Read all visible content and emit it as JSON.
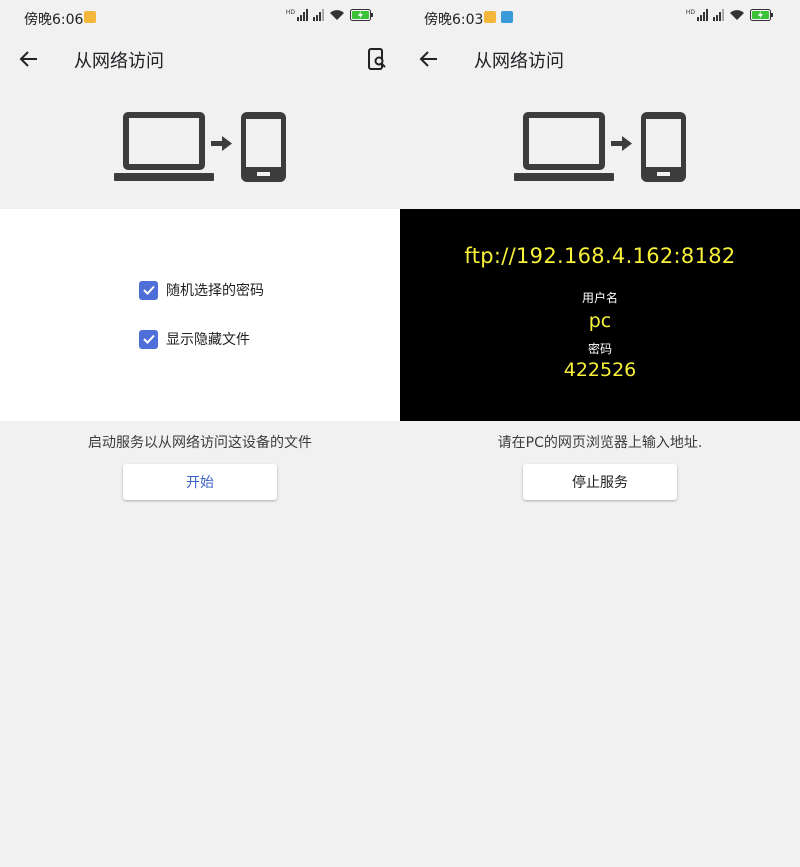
{
  "left_screen": {
    "status_bar": {
      "time": "傍晚6:06",
      "network_label": "HD"
    },
    "app_bar": {
      "title": "从网络访问"
    },
    "options": [
      {
        "label": "随机选择的密码",
        "checked": true
      },
      {
        "label": "显示隐藏文件",
        "checked": true
      }
    ],
    "caption": "启动服务以从网络访问这设备的文件",
    "button_label": "开始"
  },
  "right_screen": {
    "status_bar": {
      "time": "傍晚6:03",
      "network_label": "HD"
    },
    "app_bar": {
      "title": "从网络访问"
    },
    "server": {
      "url": "ftp://192.168.4.162:8182",
      "username_label": "用户名",
      "username": "pc",
      "password_label": "密码",
      "password": "422526"
    },
    "caption": "请在PC的网页浏览器上输入地址.",
    "button_label": "停止服务"
  },
  "colors": {
    "background": "#f1f1f2",
    "accent": "#4e6fd7",
    "highlight_text": "#f7f13a",
    "device_icon": "#3c3c3c"
  },
  "icons": [
    "back-arrow-icon",
    "search-device-icon",
    "laptop-icon",
    "arrow-right-icon",
    "phone-icon",
    "wifi-icon",
    "battery-icon",
    "signal-icon",
    "checkbox-checked-icon"
  ]
}
